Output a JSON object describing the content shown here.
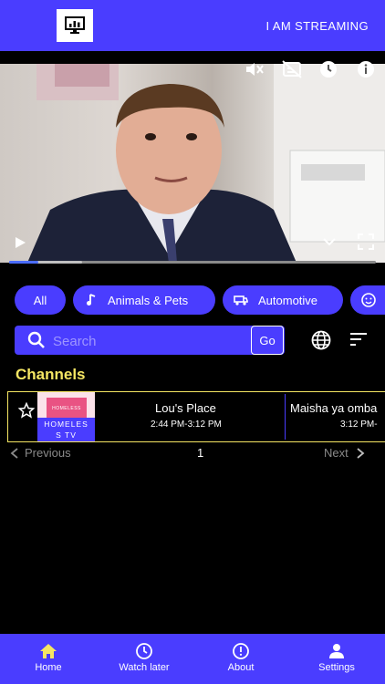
{
  "header": {
    "title": "I AM STREAMING",
    "logo_icon": "monitor-chart-icon"
  },
  "player": {
    "icons": [
      "mute-icon",
      "captions-off-icon",
      "clock-icon",
      "info-icon",
      "play-icon",
      "chevron-down-icon",
      "fullscreen-icon"
    ],
    "progress_fraction": 0.08,
    "buffered_fraction": 0.2
  },
  "categories": [
    {
      "label": "All",
      "icon": ""
    },
    {
      "label": "Animals & Pets",
      "icon": "music-note-icon"
    },
    {
      "label": "Automotive",
      "icon": "car-icon"
    },
    {
      "label": "",
      "icon": "smiley-icon"
    }
  ],
  "search": {
    "placeholder": "Search",
    "go_label": "Go"
  },
  "section_title": "Channels",
  "channel": {
    "name_line1": "HOMELES",
    "name_line2": "S TV",
    "thumb_text": "HOMELESS",
    "programs": [
      {
        "title": "Lou's Place",
        "time": "2:44 PM-3:12 PM"
      },
      {
        "title": "Maisha ya omba",
        "time": "3:12 PM-"
      }
    ]
  },
  "pager": {
    "previous": "Previous",
    "page": "1",
    "next": "Next"
  },
  "nav": [
    {
      "label": "Home",
      "icon": "home-icon",
      "active": true
    },
    {
      "label": "Watch later",
      "icon": "clock-icon",
      "active": false
    },
    {
      "label": "About",
      "icon": "info-icon",
      "active": false
    },
    {
      "label": "Settings",
      "icon": "user-icon",
      "active": false
    }
  ],
  "colors": {
    "brand": "#4a3dff",
    "accent": "#f5e663",
    "background": "#000000"
  }
}
